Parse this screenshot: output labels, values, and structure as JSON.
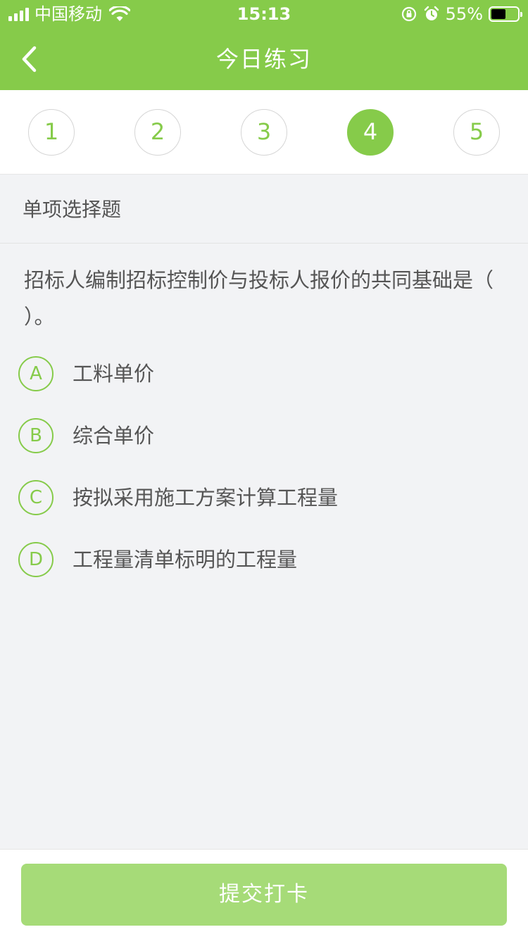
{
  "status_bar": {
    "carrier": "中国移动",
    "time": "15:13",
    "battery_percent": "55%",
    "battery_level": 0.55
  },
  "header": {
    "title": "今日练习",
    "back_icon": "chevron-left-icon"
  },
  "question_numbers": [
    "1",
    "2",
    "3",
    "4",
    "5"
  ],
  "active_question": "4",
  "question": {
    "type": "单项选择题",
    "text": "招标人编制招标控制价与投标人报价的共同基础是（ ）。",
    "options": [
      {
        "letter": "A",
        "text": "工料单价"
      },
      {
        "letter": "B",
        "text": "综合单价"
      },
      {
        "letter": "C",
        "text": "按拟采用施工方案计算工程量"
      },
      {
        "letter": "D",
        "text": "工程量清单标明的工程量"
      }
    ]
  },
  "submit_label": "提交打卡",
  "colors": {
    "primary": "#86cb4a",
    "submit_disabled": "#a6db78",
    "text": "#555555",
    "background": "#f2f3f5"
  }
}
